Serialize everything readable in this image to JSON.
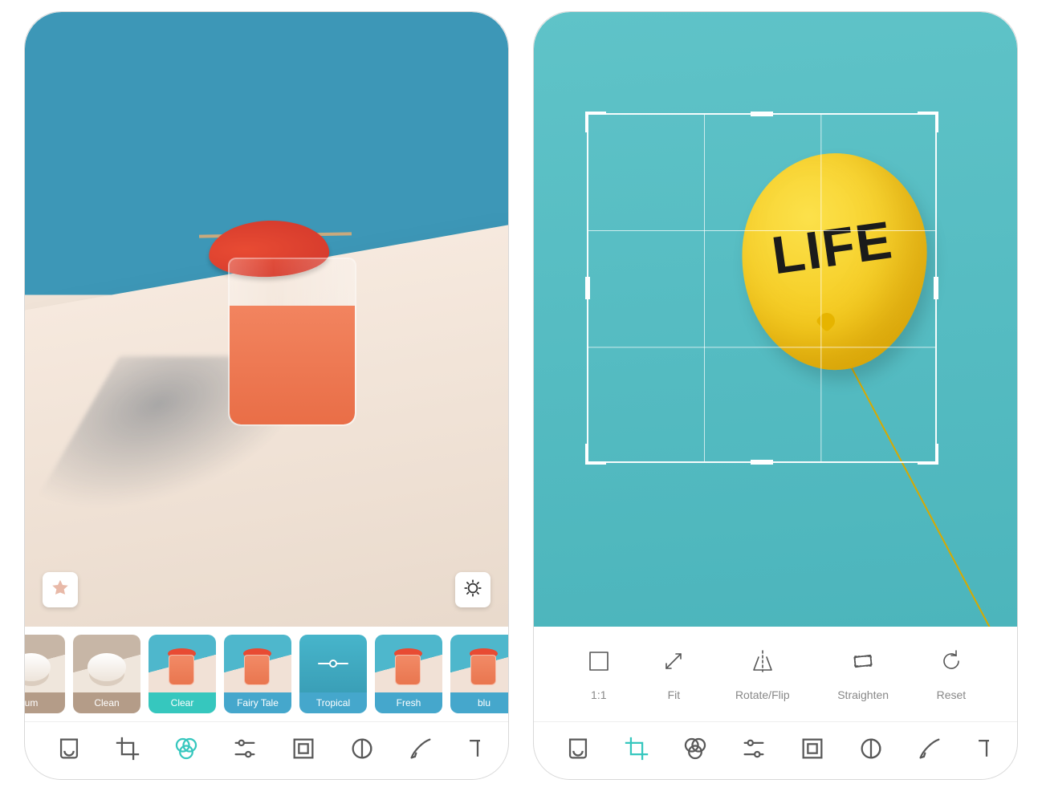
{
  "device1": {
    "preview_buttons": {
      "favorite": "star-icon",
      "compare": "compare-icon"
    },
    "filters": [
      {
        "label": "um",
        "style": "swirl",
        "tone": "tan"
      },
      {
        "label": "Clean",
        "style": "swirl",
        "tone": "tan"
      },
      {
        "label": "Clear",
        "style": "cocktail",
        "tone": "active"
      },
      {
        "label": "Fairy Tale",
        "style": "cocktail",
        "tone": "blue"
      },
      {
        "label": "Tropical",
        "style": "tropical",
        "tone": "blue"
      },
      {
        "label": "Fresh",
        "style": "cocktail",
        "tone": "blue"
      },
      {
        "label": "blu",
        "style": "cocktail",
        "tone": "blue"
      }
    ],
    "toolbar": [
      {
        "name": "auto-icon",
        "active": false,
        "partial": false
      },
      {
        "name": "crop-icon",
        "active": false,
        "partial": false
      },
      {
        "name": "filters-icon",
        "active": true,
        "partial": false
      },
      {
        "name": "adjust-icon",
        "active": false,
        "partial": false
      },
      {
        "name": "frame-icon",
        "active": false,
        "partial": false
      },
      {
        "name": "shape-icon",
        "active": false,
        "partial": false
      },
      {
        "name": "brush-icon",
        "active": false,
        "partial": false
      },
      {
        "name": "text-icon",
        "active": false,
        "partial": true
      }
    ]
  },
  "device2": {
    "balloon_text": "LIFE",
    "crop_tools": [
      {
        "label": "1:1",
        "icon": "ratio-icon"
      },
      {
        "label": "Fit",
        "icon": "fit-icon"
      },
      {
        "label": "Rotate/Flip",
        "icon": "rotateflip-icon"
      },
      {
        "label": "Straighten",
        "icon": "straighten-icon"
      },
      {
        "label": "Reset",
        "icon": "reset-icon"
      }
    ],
    "toolbar": [
      {
        "name": "auto-icon",
        "active": false,
        "partial": false
      },
      {
        "name": "crop-icon",
        "active": true,
        "partial": false
      },
      {
        "name": "filters-icon",
        "active": false,
        "partial": false
      },
      {
        "name": "adjust-icon",
        "active": false,
        "partial": false
      },
      {
        "name": "frame-icon",
        "active": false,
        "partial": false
      },
      {
        "name": "shape-icon",
        "active": false,
        "partial": false
      },
      {
        "name": "brush-icon",
        "active": false,
        "partial": false
      },
      {
        "name": "text-icon",
        "active": false,
        "partial": true
      }
    ]
  }
}
